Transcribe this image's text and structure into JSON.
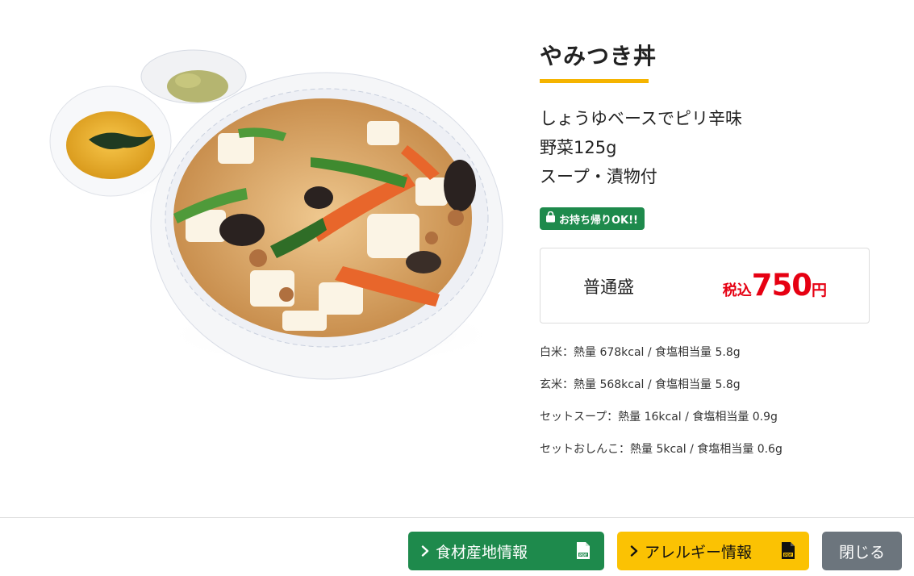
{
  "product": {
    "title": "やみつき丼",
    "description": [
      "しょうゆベースでピリ辛味",
      "野菜125g",
      "スープ・漬物付"
    ],
    "takeout_badge": "お持ち帰りOK!!",
    "size_label": "普通盛",
    "price_prefix": "税込",
    "price": "750",
    "price_unit": "円"
  },
  "nutrition": [
    "白米：熱量 678kcal / 食塩相当量 5.8g",
    "玄米：熱量 568kcal / 食塩相当量 5.8g",
    "セットスープ：熱量 16kcal / 食塩相当量 0.9g",
    "セットおしんこ：熱量 5kcal / 食塩相当量 0.6g"
  ],
  "footer": {
    "origin_button": "食材産地情報",
    "allergy_button": "アレルギー情報",
    "close_button": "閉じる"
  },
  "icons": {
    "chevron": "chevron-right-icon",
    "pdf": "pdf-file-icon",
    "bag": "shopping-bag-icon"
  },
  "colors": {
    "accent": "#f5b400",
    "green": "#1e8a4c",
    "yellow": "#fbc203",
    "gray": "#6c757d",
    "price_red": "#e60012"
  }
}
